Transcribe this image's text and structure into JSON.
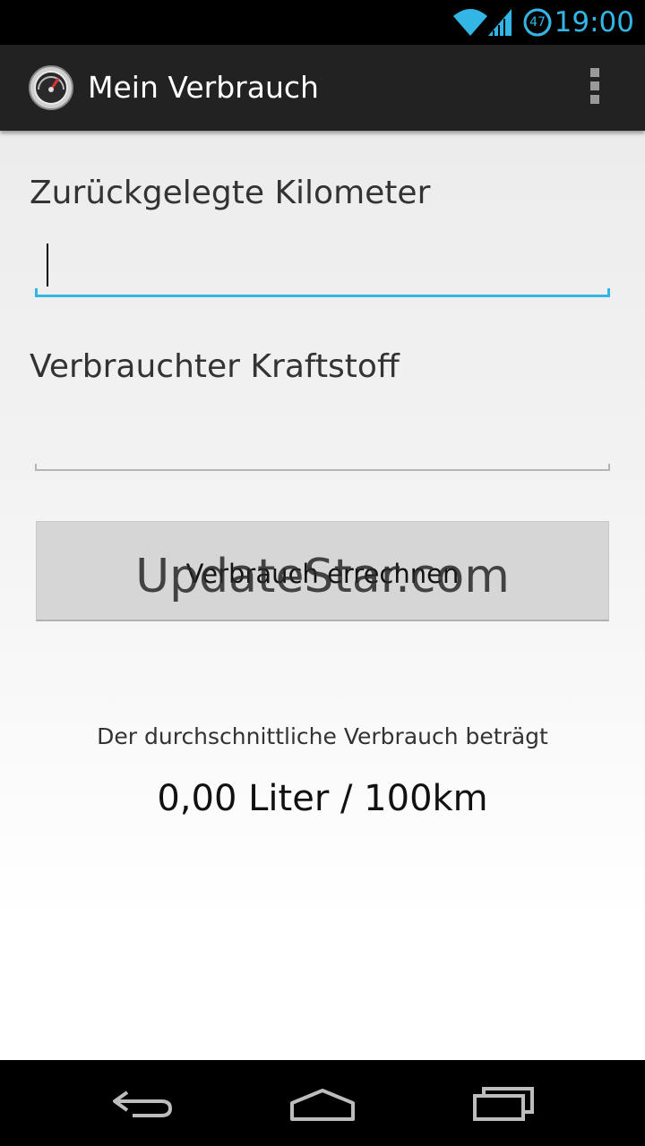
{
  "status_bar": {
    "time": "19:00",
    "battery_level": "47",
    "wifi_icon": "wifi-icon",
    "signal_icon": "cell-signal-icon",
    "battery_icon": "battery-icon",
    "accent_color": "#33b5e5"
  },
  "action_bar": {
    "title": "Mein Verbrauch",
    "app_icon": "speedometer-icon",
    "overflow_icon": "overflow-menu-icon"
  },
  "form": {
    "km_label": "Zurückgelegte Kilometer",
    "km_value": "",
    "fuel_label": "Verbrauchter Kraftstoff",
    "fuel_value": "",
    "calc_button_label": "Verbrauch errechnen"
  },
  "watermark": {
    "text": "UpdateStar.com"
  },
  "result": {
    "caption": "Der durchschnittliche Verbrauch beträgt",
    "value": "0,00 Liter / 100km"
  },
  "nav_bar": {
    "back_icon": "back-icon",
    "home_icon": "home-icon",
    "recents_icon": "recent-apps-icon"
  }
}
